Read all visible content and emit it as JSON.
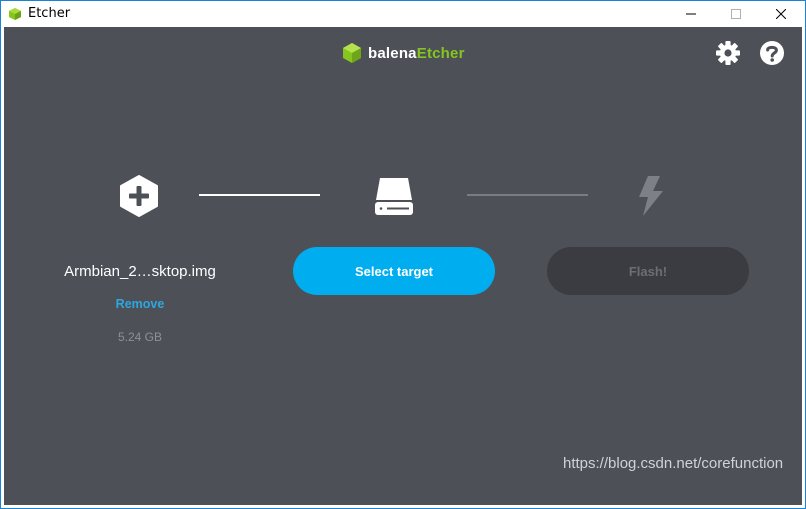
{
  "window": {
    "title": "Etcher",
    "controls": {
      "minimize": "minimize-icon",
      "maximize": "maximize-icon",
      "close": "close-icon"
    }
  },
  "brand": {
    "part1": "balena",
    "part2": "Etcher",
    "logo_color": "#85c51e"
  },
  "header_icons": {
    "settings": "gear-icon",
    "help": "help-icon"
  },
  "steps": {
    "image": {
      "icon": "plus-hexagon-icon",
      "file_name": "Armbian_2…sktop.img",
      "remove_label": "Remove",
      "size": "5.24 GB"
    },
    "target": {
      "icon": "drive-icon",
      "button_label": "Select target"
    },
    "flash": {
      "icon": "lightning-icon",
      "button_label": "Flash!"
    }
  },
  "watermark": "https://blog.csdn.net/corefunction",
  "colors": {
    "background": "#4d5057",
    "accent": "#00aeef",
    "link": "#2ea7e0",
    "disabled_button": "#3a3c41"
  }
}
